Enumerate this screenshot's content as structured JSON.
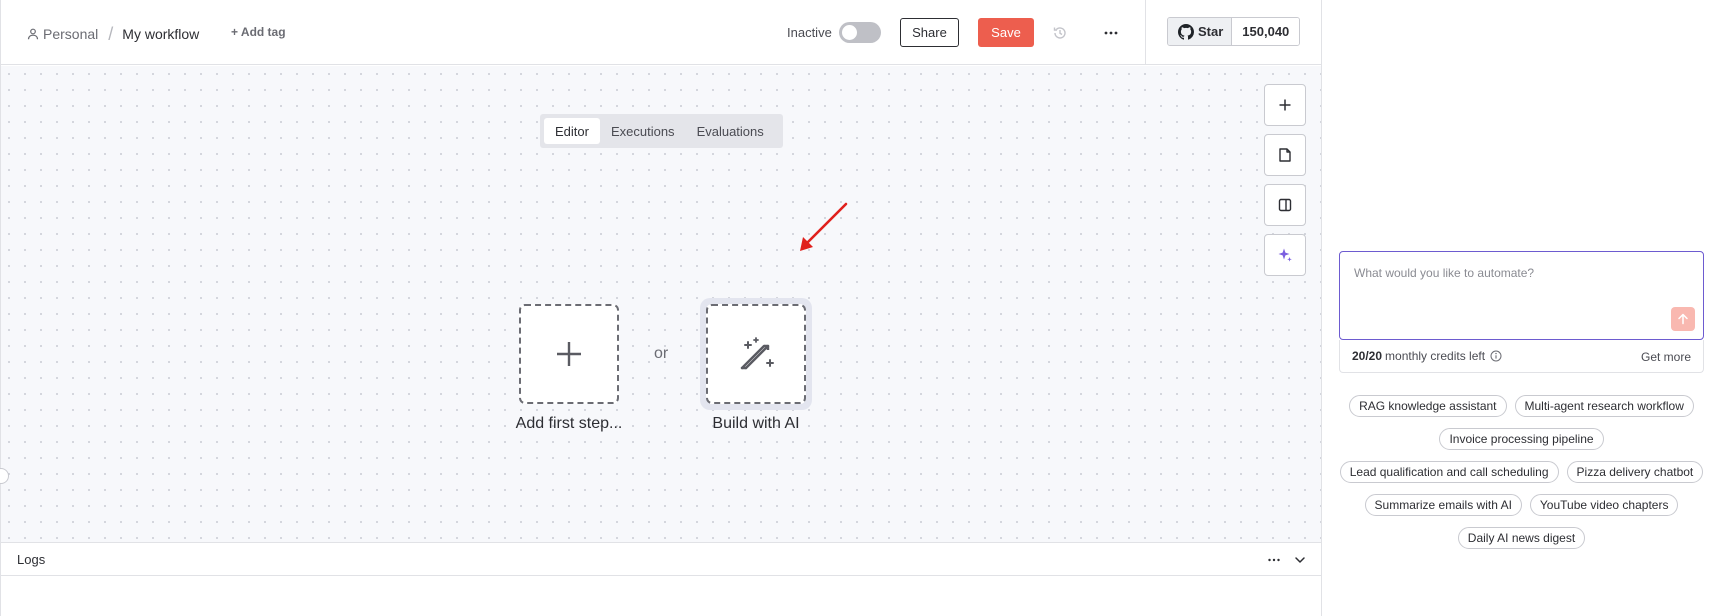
{
  "header": {
    "breadcrumb_project": "Personal",
    "breadcrumb_separator": "/",
    "workflow_name": "My workflow",
    "add_tag_label": "+ Add tag",
    "active_status_label": "Inactive",
    "active_toggle_on": false,
    "share_label": "Share",
    "save_label": "Save",
    "github_star_label": "Star",
    "github_star_count": "150,040"
  },
  "tabs": [
    {
      "label": "Editor",
      "active": true
    },
    {
      "label": "Executions",
      "active": false
    },
    {
      "label": "Evaluations",
      "active": false
    }
  ],
  "canvas": {
    "add_step_label": "Add first step...",
    "or_label": "or",
    "build_ai_label": "Build with AI"
  },
  "logs": {
    "title": "Logs"
  },
  "ai_panel": {
    "prompt_placeholder": "What would you like to automate?",
    "credits_count": "20/20",
    "credits_text": "monthly credits left",
    "get_more_label": "Get more",
    "suggestions": [
      "RAG knowledge assistant",
      "Multi-agent research workflow",
      "Invoice processing pipeline",
      "Lead qualification and call scheduling",
      "Pizza delivery chatbot",
      "Summarize emails with AI",
      "YouTube video chapters",
      "Daily AI news digest"
    ]
  },
  "colors": {
    "accent_save": "#ed5e4e",
    "accent_ai": "#6d5bd0",
    "annotation_arrow": "#e0201c"
  },
  "icons": {
    "user": "user-icon",
    "history": "history-icon",
    "more": "ellipsis-icon",
    "github": "github-icon",
    "plus": "plus-icon",
    "sticky_note": "sticky-note-icon",
    "panel": "panel-icon",
    "ai_sparkle": "sparkles-icon",
    "magic_wand": "magic-wand-icon",
    "fit_view": "fit-view-icon",
    "zoom_in": "zoom-in-icon",
    "zoom_out": "zoom-out-icon",
    "tidy_up": "tidy-up-icon",
    "chevron_down": "chevron-down-icon",
    "send": "arrow-up-icon",
    "info": "info-icon"
  }
}
